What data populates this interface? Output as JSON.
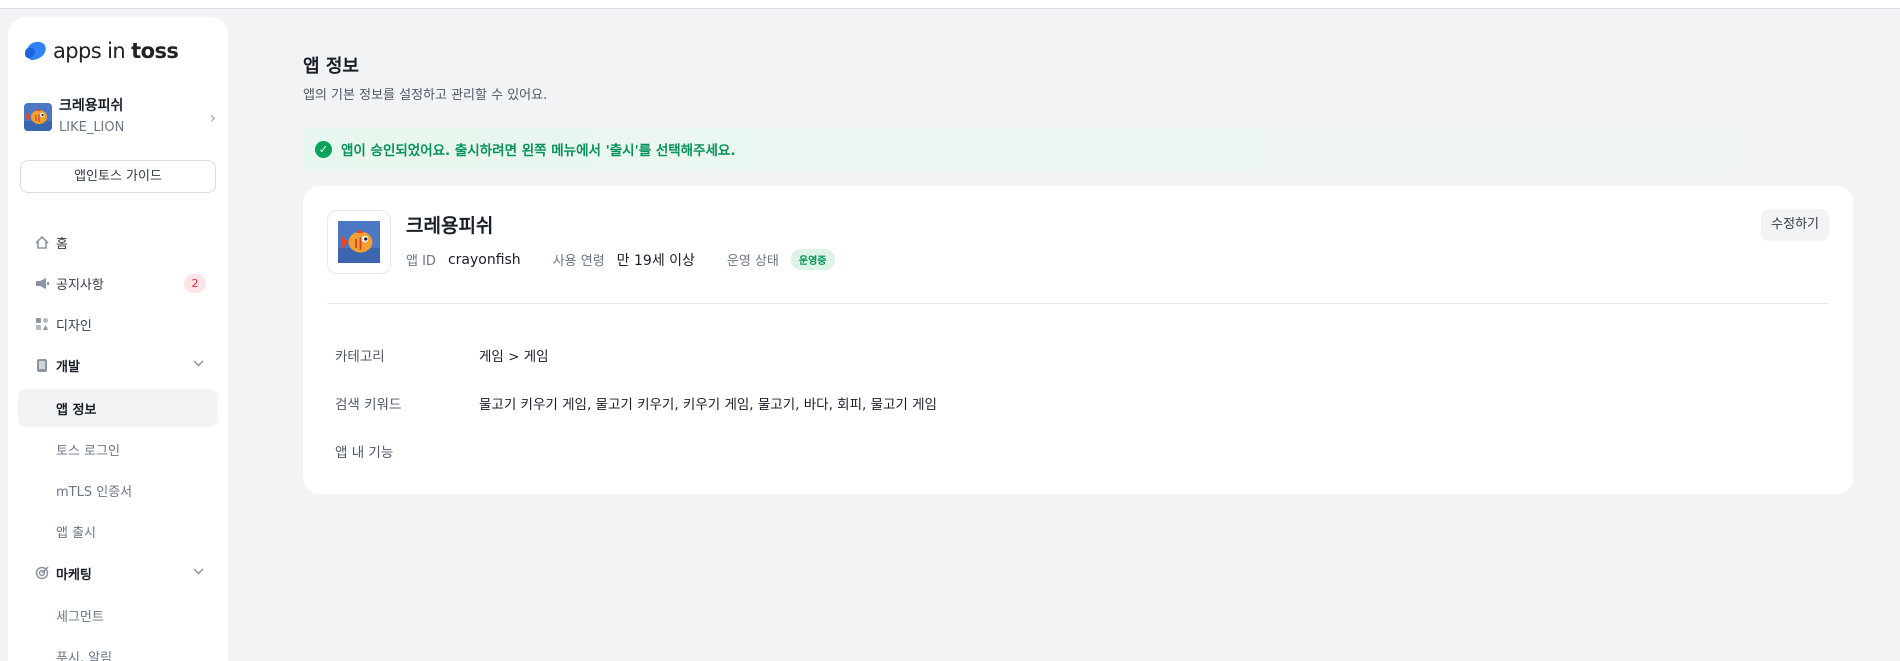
{
  "brand": {
    "logo_text_a": "apps in ",
    "logo_text_b": "toss"
  },
  "sidebar": {
    "app": {
      "name": "크레용피쉬",
      "org": "LIKE_LION"
    },
    "guide_button": "앱인토스 가이드",
    "items": [
      {
        "label": "홈",
        "icon": "home-icon"
      },
      {
        "label": "공지사항",
        "icon": "megaphone-icon",
        "badge": "2"
      },
      {
        "label": "디자인",
        "icon": "design-icon"
      },
      {
        "label": "개발",
        "icon": "device-icon"
      },
      {
        "label": "앱 정보"
      },
      {
        "label": "토스 로그인"
      },
      {
        "label": "mTLS 인증서"
      },
      {
        "label": "앱 출시"
      },
      {
        "label": "마케팅",
        "icon": "target-icon"
      },
      {
        "label": "세그먼트"
      },
      {
        "label": "푸시, 알림"
      }
    ]
  },
  "main": {
    "title": "앱 정보",
    "description": "앱의 기본 정보를 설정하고 관리할 수 있어요.",
    "banner": "앱이 승인되었어요. 출시하려면 왼쪽 메뉴에서 '출시'를 선택해주세요.",
    "card": {
      "app_name": "크레용피쉬",
      "edit_button": "수정하기",
      "app_id_label": "앱 ID",
      "app_id": "crayonfish",
      "age_label": "사용 연령",
      "age": "만 19세 이상",
      "status_label": "운영 상태",
      "status": "운영중",
      "rows": [
        {
          "key": "카테고리",
          "value": "게임 > 게임"
        },
        {
          "key": "검색 키워드",
          "value": "물고기 키우기 게임, 물고기 키우기, 키우기 게임, 물고기, 바다, 회피, 물고기 게임"
        },
        {
          "key": "앱 내 기능",
          "value": ""
        }
      ]
    }
  },
  "colors": {
    "accent_green": "#05935a",
    "badge_red": "#e42939",
    "brand_blue": "#3182f6"
  }
}
